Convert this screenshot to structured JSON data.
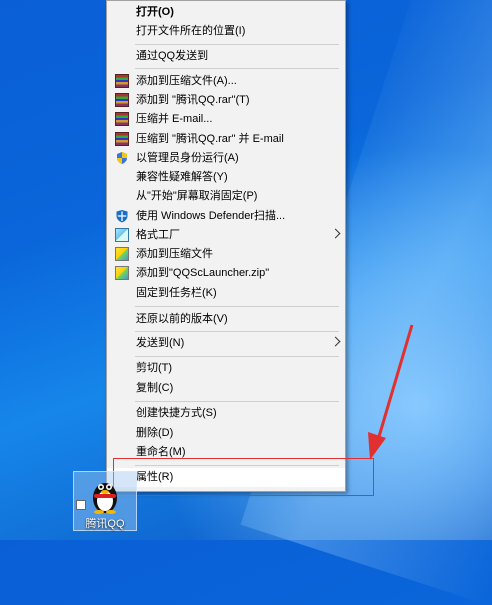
{
  "menu": {
    "items": [
      {
        "label": "打开(O)",
        "icon": "none",
        "bold": true
      },
      {
        "label": "打开文件所在的位置(I)",
        "icon": "none"
      },
      {
        "label": "通过QQ发送到",
        "icon": "none"
      },
      {
        "label": "添加到压缩文件(A)...",
        "icon": "winrar-icon"
      },
      {
        "label": "添加到 \"腾讯QQ.rar\"(T)",
        "icon": "winrar-icon"
      },
      {
        "label": "压缩并 E-mail...",
        "icon": "winrar-icon"
      },
      {
        "label": "压缩到 \"腾讯QQ.rar\" 并 E-mail",
        "icon": "winrar-icon"
      },
      {
        "label": "以管理员身份运行(A)",
        "icon": "shield-icon"
      },
      {
        "label": "兼容性疑难解答(Y)",
        "icon": "none"
      },
      {
        "label": "从\"开始\"屏幕取消固定(P)",
        "icon": "none"
      },
      {
        "label": "使用 Windows Defender扫描...",
        "icon": "defender-icon"
      },
      {
        "label": "格式工厂",
        "icon": "format-factory-icon",
        "submenu": true
      },
      {
        "label": "添加到压缩文件",
        "icon": "zip-icon"
      },
      {
        "label": "添加到\"QQScLauncher.zip\"",
        "icon": "zip-icon"
      },
      {
        "label": "固定到任务栏(K)",
        "icon": "none"
      },
      {
        "label": "还原以前的版本(V)",
        "icon": "none"
      },
      {
        "label": "发送到(N)",
        "icon": "none",
        "submenu": true
      },
      {
        "label": "剪切(T)",
        "icon": "none"
      },
      {
        "label": "复制(C)",
        "icon": "none"
      },
      {
        "label": "创建快捷方式(S)",
        "icon": "none"
      },
      {
        "label": "删除(D)",
        "icon": "none"
      },
      {
        "label": "重命名(M)",
        "icon": "none"
      },
      {
        "label": "属性(R)",
        "icon": "none",
        "highlighted": true
      }
    ]
  },
  "desktop": {
    "shortcut_label": "腾讯QQ"
  },
  "colors": {
    "annotation": "#e03030",
    "menu_bg": "#f2f2f2"
  }
}
